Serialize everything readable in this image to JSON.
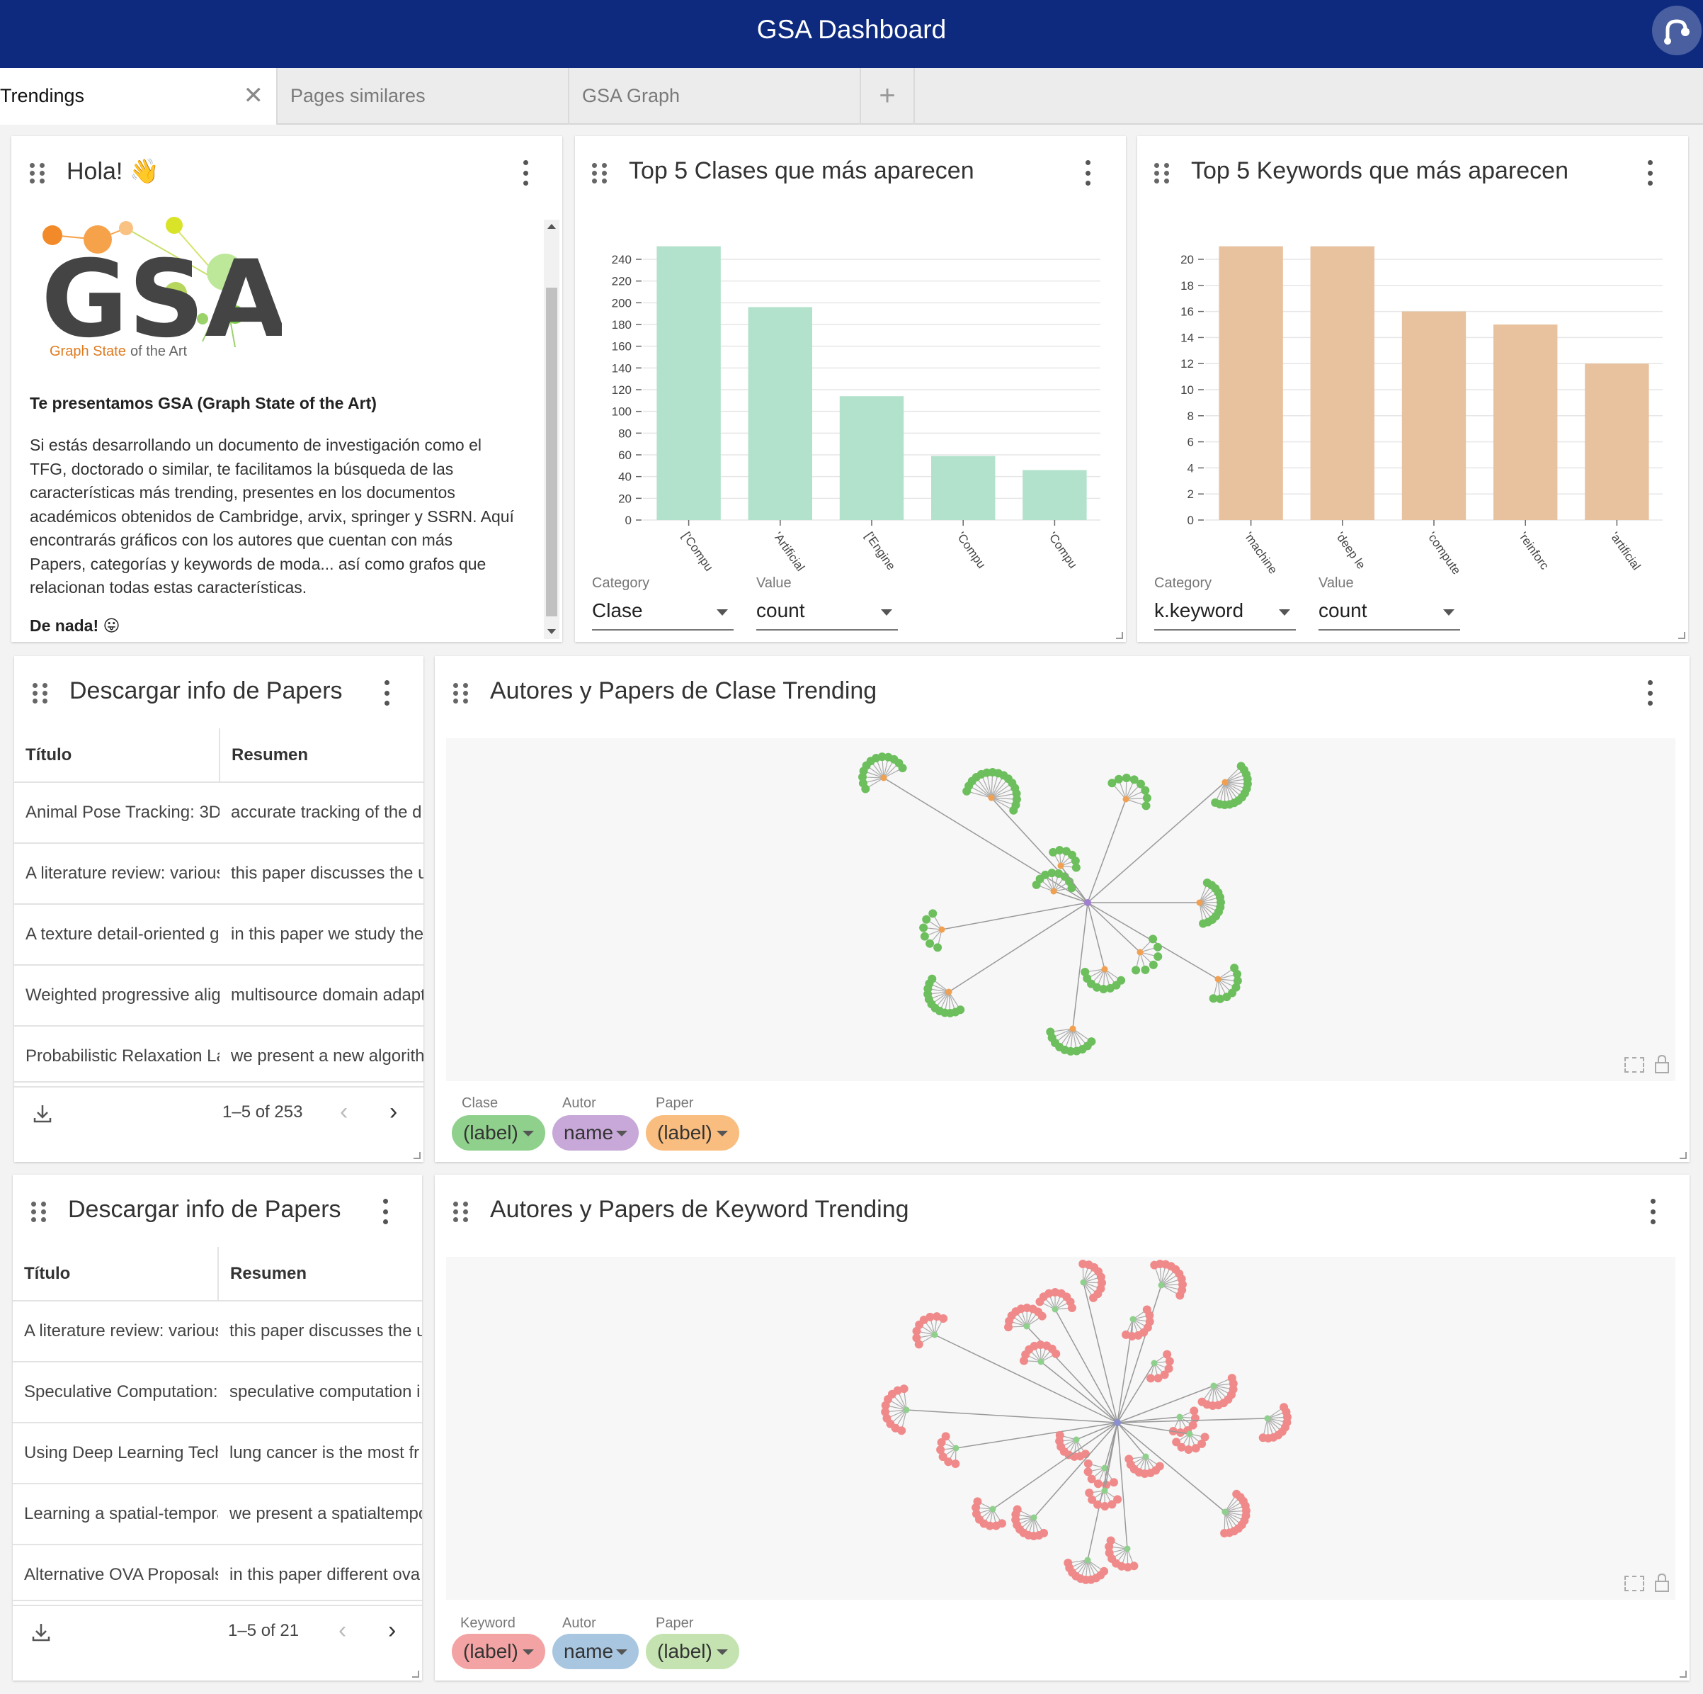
{
  "app": {
    "title": "GSA Dashboard"
  },
  "tabs": [
    {
      "label": "Trendings",
      "active": true
    },
    {
      "label": "Pages similares",
      "active": false
    },
    {
      "label": "GSA Graph",
      "active": false
    }
  ],
  "colors": {
    "header": "#0d2a7f",
    "clase_bar": "#b3e2cc",
    "keyword_bar": "#e8c29f"
  },
  "intro": {
    "title": "Hola! 👋",
    "logo_text": "GSA",
    "logo_caption_1": "Graph State",
    "logo_caption_2": "of the Art",
    "heading": "Te presentamos GSA (Graph State of the Art)",
    "body_lines": [
      "Si estás desarrollando un documento de investigación como el",
      "TFG, doctorado o similar, te facilitamos la búsqueda de las",
      "características más trending, presentes en los documentos",
      "académicos obtenidos de Cambridge, arvix, springer y SSRN. Aquí",
      "encontrarás gráficos con los autores que cuentan con más",
      "Papers, categorías y keywords de moda... así como grafos que",
      "relacionan todas estas características."
    ],
    "signoff": "De nada! 😛"
  },
  "chart_clases": {
    "title": "Top 5 Clases que más aparecen",
    "category_label": "Category",
    "category_value": "Clase",
    "value_label": "Value",
    "value_value": "count"
  },
  "chart_keywords": {
    "title": "Top 5 Keywords que más aparecen",
    "category_label": "Category",
    "category_value": "k.keyword",
    "value_label": "Value",
    "value_value": "count"
  },
  "chart_data": [
    {
      "type": "bar",
      "title": "Top 5 Clases que más aparecen",
      "categories": [
        "['Compu",
        "'Artificial",
        "['Engine",
        "'Compu",
        "'Compu"
      ],
      "values": [
        252,
        196,
        114,
        59,
        46
      ],
      "ylim": [
        0,
        240
      ],
      "yticks": [
        0,
        20,
        40,
        60,
        80,
        100,
        120,
        140,
        160,
        180,
        200,
        220,
        240
      ],
      "grid": true,
      "color": "#b3e2cc"
    },
    {
      "type": "bar",
      "title": "Top 5 Keywords que más aparecen",
      "categories": [
        "'machine",
        "'deep le",
        "'compute",
        "'reinforc",
        "'artificial"
      ],
      "values": [
        21,
        21,
        16,
        15,
        12
      ],
      "ylim": [
        0,
        20
      ],
      "yticks": [
        0,
        2,
        4,
        6,
        8,
        10,
        12,
        14,
        16,
        18,
        20
      ],
      "grid": true,
      "color": "#e8c29f"
    }
  ],
  "papers1": {
    "title": "Descargar info de Papers",
    "col_title": "Título",
    "col_summary": "Resumen",
    "rows": [
      {
        "title": "Animal Pose Tracking: 3D",
        "summary": "accurate tracking of the d"
      },
      {
        "title": "A literature review: various",
        "summary": "this paper discusses the u"
      },
      {
        "title": "A texture detail-oriented g",
        "summary": "in this paper we study the"
      },
      {
        "title": "Weighted progressive alig",
        "summary": "multisource domain adapt"
      },
      {
        "title": "Probabilistic Relaxation La",
        "summary": "we present a new algorith"
      }
    ],
    "pagination": "1–5 of 253"
  },
  "papers2": {
    "title": "Descargar info de Papers",
    "col_title": "Título",
    "col_summary": "Resumen",
    "rows": [
      {
        "title": "A literature review: various",
        "summary": "this paper discusses the u"
      },
      {
        "title": "Speculative Computation:",
        "summary": "speculative computation i"
      },
      {
        "title": "Using Deep Learning Tech",
        "summary": "lung cancer is the most fr"
      },
      {
        "title": "Learning a spatial-tempora",
        "summary": "we present a spatialtempo"
      },
      {
        "title": "Alternative OVA Proposals",
        "summary": "in this paper different ova"
      }
    ],
    "pagination": "1–5 of 21"
  },
  "graph_clase": {
    "title": "Autores y Papers de Clase Trending",
    "legend": [
      {
        "label": "Clase",
        "value": "(label)",
        "color": "#8fd08c"
      },
      {
        "label": "Autor",
        "value": "name",
        "color": "#c7a8d8"
      },
      {
        "label": "Paper",
        "value": "(label)",
        "color": "#f9bd80"
      }
    ]
  },
  "graph_keyword": {
    "title": "Autores y Papers de Keyword Trending",
    "legend": [
      {
        "label": "Keyword",
        "value": "(label)",
        "color": "#f3a3a3"
      },
      {
        "label": "Autor",
        "value": "name",
        "color": "#a9c6e0"
      },
      {
        "label": "Paper",
        "value": "(label)",
        "color": "#c4e3b0"
      }
    ]
  }
}
